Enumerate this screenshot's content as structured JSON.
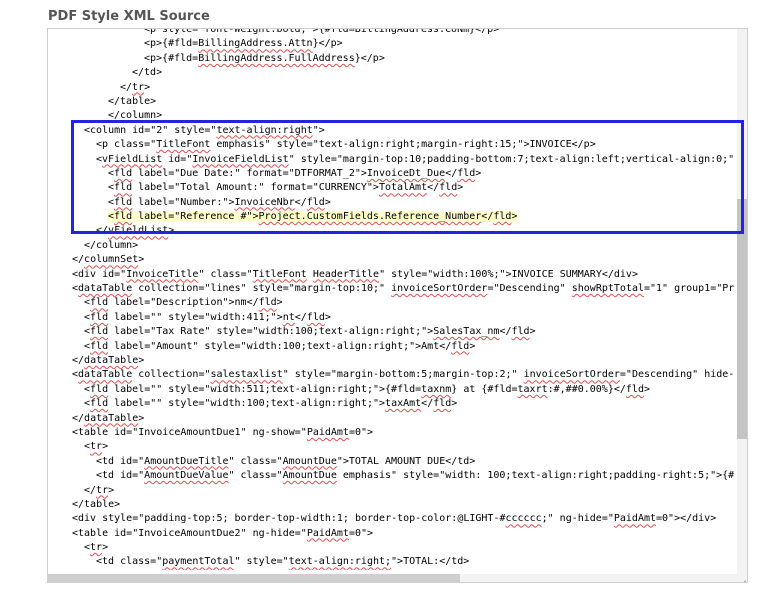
{
  "section_title": "PDF Style XML Source",
  "highlight_color": "#2323e6",
  "lines": [
    {
      "indent": 6,
      "parts": [
        {
          "t": "<p style= font-Weight:bold; >{#fld=BillingAddress.CoNm}</p>"
        }
      ]
    },
    {
      "indent": 6,
      "parts": [
        {
          "t": "<p>{#fld="
        },
        {
          "t": "BillingAddress.Attn",
          "s": true
        },
        {
          "t": "}</p>"
        }
      ]
    },
    {
      "indent": 6,
      "parts": [
        {
          "t": "<p>{#fld="
        },
        {
          "t": "BillingAddress.FullAddress",
          "s": true
        },
        {
          "t": "}</p>"
        }
      ]
    },
    {
      "indent": 5,
      "parts": [
        {
          "t": "</td>"
        }
      ]
    },
    {
      "indent": 4,
      "parts": [
        {
          "t": "</"
        },
        {
          "t": "tr",
          "s": true
        },
        {
          "t": ">"
        }
      ]
    },
    {
      "indent": 3,
      "parts": [
        {
          "t": "</table>"
        }
      ]
    },
    {
      "indent": 3,
      "parts": [
        {
          "t": "</column>"
        }
      ]
    },
    {
      "indent": 1,
      "parts": [
        {
          "t": "<column id=\"2\" style=\""
        },
        {
          "t": "text-align:right",
          "s": true
        },
        {
          "t": "\">"
        }
      ]
    },
    {
      "indent": 2,
      "parts": [
        {
          "t": "<p class=\""
        },
        {
          "t": "TitleFont",
          "s": true
        },
        {
          "t": " emphasis\" style=\"text-align:right;margin-right:15;\">INVOICE</p>"
        }
      ]
    },
    {
      "indent": 2,
      "parts": [
        {
          "t": "<"
        },
        {
          "t": "vFieldList",
          "s": true
        },
        {
          "t": " id=\""
        },
        {
          "t": "InvoiceFieldList",
          "s": true
        },
        {
          "t": "\" style=\"margin-top:10;padding-bottom:7;text-align:left;vertical-align:0;\""
        }
      ]
    },
    {
      "indent": 3,
      "parts": [
        {
          "t": "<"
        },
        {
          "t": "fld",
          "s": true
        },
        {
          "t": " label=\"Due Date:\" format=\"DTFORMAT_2\">"
        },
        {
          "t": "InvoiceDt_Due",
          "s": true
        },
        {
          "t": "</"
        },
        {
          "t": "fld",
          "s": true
        },
        {
          "t": ">"
        }
      ]
    },
    {
      "indent": 3,
      "parts": [
        {
          "t": "<"
        },
        {
          "t": "fld",
          "s": true
        },
        {
          "t": " label=\"Total Amount:\" format=\"CURRENCY\">"
        },
        {
          "t": "TotalAmt",
          "s": true
        },
        {
          "t": "</"
        },
        {
          "t": "fld",
          "s": true
        },
        {
          "t": ">"
        }
      ]
    },
    {
      "indent": 3,
      "parts": [
        {
          "t": "<"
        },
        {
          "t": "fld",
          "s": true
        },
        {
          "t": " label=\"Number:\">"
        },
        {
          "t": "InvoiceNbr",
          "s": true
        },
        {
          "t": "</"
        },
        {
          "t": "fld",
          "s": true
        },
        {
          "t": ">"
        }
      ]
    },
    {
      "indent": 3,
      "hl": true,
      "parts": [
        {
          "t": "<"
        },
        {
          "t": "fld",
          "s": true
        },
        {
          "t": " label=\"Reference #\">"
        },
        {
          "t": "Project.CustomFields.Reference_Number",
          "s": true
        },
        {
          "t": "</"
        },
        {
          "t": "fld",
          "s": true
        },
        {
          "t": ">"
        }
      ]
    },
    {
      "indent": 2,
      "parts": [
        {
          "t": "</"
        },
        {
          "t": "vFieldList",
          "s": true
        },
        {
          "t": ">"
        }
      ]
    },
    {
      "indent": 1,
      "parts": [
        {
          "t": "</column>"
        }
      ]
    },
    {
      "indent": 0,
      "parts": [
        {
          "t": "</"
        },
        {
          "t": "columnSet",
          "s": true
        },
        {
          "t": ">"
        }
      ]
    },
    {
      "indent": 0,
      "parts": [
        {
          "t": "<div id=\""
        },
        {
          "t": "InvoiceTitle",
          "s": true
        },
        {
          "t": "\" class=\""
        },
        {
          "t": "TitleFont",
          "s": true
        },
        {
          "t": " "
        },
        {
          "t": "HeaderTitle",
          "s": true
        },
        {
          "t": "\" style=\"width:100%;\">INVOICE SUMMARY</div>"
        }
      ]
    },
    {
      "indent": 0,
      "parts": [
        {
          "t": "<"
        },
        {
          "t": "dataTable",
          "s": true
        },
        {
          "t": " collection=\"lines\" style=\"margin-top:10;\" "
        },
        {
          "t": "invoiceSortOrder",
          "s": true
        },
        {
          "t": "=\"Descending\" "
        },
        {
          "t": "showRptTotal",
          "s": true
        },
        {
          "t": "=\"1\" group1=\"Pr"
        }
      ]
    },
    {
      "indent": 1,
      "parts": [
        {
          "t": "<"
        },
        {
          "t": "fld",
          "s": true
        },
        {
          "t": " label=\"Description\">nm</"
        },
        {
          "t": "fld",
          "s": true
        },
        {
          "t": ">"
        }
      ]
    },
    {
      "indent": 1,
      "parts": [
        {
          "t": "<"
        },
        {
          "t": "fld",
          "s": true
        },
        {
          "t": " label=\"\" style=\"width:411;\">"
        },
        {
          "t": "nt",
          "s": true
        },
        {
          "t": "</"
        },
        {
          "t": "fld",
          "s": true
        },
        {
          "t": ">"
        }
      ]
    },
    {
      "indent": 1,
      "parts": [
        {
          "t": "<"
        },
        {
          "t": "fld",
          "s": true
        },
        {
          "t": " label=\"Tax Rate\" style=\"width:100;text-align:right;\">"
        },
        {
          "t": "SalesTax_nm",
          "s": true
        },
        {
          "t": "</"
        },
        {
          "t": "fld",
          "s": true
        },
        {
          "t": ">"
        }
      ]
    },
    {
      "indent": 1,
      "parts": [
        {
          "t": "<"
        },
        {
          "t": "fld",
          "s": true
        },
        {
          "t": " label=\"Amount\" style=\"width:100;text-align:right;\">Amt</"
        },
        {
          "t": "fld",
          "s": true
        },
        {
          "t": ">"
        }
      ]
    },
    {
      "indent": 0,
      "parts": [
        {
          "t": "</"
        },
        {
          "t": "dataTable",
          "s": true
        },
        {
          "t": ">"
        }
      ]
    },
    {
      "indent": 0,
      "parts": [
        {
          "t": "<"
        },
        {
          "t": "dataTable",
          "s": true
        },
        {
          "t": " collection=\""
        },
        {
          "t": "salestaxlist",
          "s": true
        },
        {
          "t": "\" style=\"margin-bottom:5;margin-top:2;\" "
        },
        {
          "t": "invoiceSortOrder",
          "s": true
        },
        {
          "t": "=\"Descending\" hide-"
        }
      ]
    },
    {
      "indent": 1,
      "parts": [
        {
          "t": "<"
        },
        {
          "t": "fld",
          "s": true
        },
        {
          "t": " label=\"\" style=\"width:511;text-align:right;\">{#fld="
        },
        {
          "t": "taxnm",
          "s": true
        },
        {
          "t": "} at {#fld="
        },
        {
          "t": "taxrt",
          "s": true
        },
        {
          "t": ":#,##0.00%}</"
        },
        {
          "t": "fld",
          "s": true
        },
        {
          "t": ">"
        }
      ]
    },
    {
      "indent": 1,
      "parts": [
        {
          "t": "<"
        },
        {
          "t": "fld",
          "s": true
        },
        {
          "t": " label=\"\" style=\"width:100;text-align:right;\">"
        },
        {
          "t": "taxAmt",
          "s": true
        },
        {
          "t": "</"
        },
        {
          "t": "fld",
          "s": true
        },
        {
          "t": ">"
        }
      ]
    },
    {
      "indent": 0,
      "parts": [
        {
          "t": "</"
        },
        {
          "t": "dataTable",
          "s": true
        },
        {
          "t": ">"
        }
      ]
    },
    {
      "indent": 0,
      "parts": [
        {
          "t": "<table id=\"InvoiceAmountDue1\" ng-show=\""
        },
        {
          "t": "PaidAmt",
          "s": true
        },
        {
          "t": "=0\">"
        }
      ]
    },
    {
      "indent": 1,
      "parts": [
        {
          "t": "<"
        },
        {
          "t": "tr",
          "s": true
        },
        {
          "t": ">"
        }
      ]
    },
    {
      "indent": 2,
      "parts": [
        {
          "t": "<td id=\""
        },
        {
          "t": "AmountDueTitle",
          "s": true
        },
        {
          "t": "\" class=\""
        },
        {
          "t": "AmountDue",
          "s": true
        },
        {
          "t": "\">TOTAL AMOUNT DUE</td>"
        }
      ]
    },
    {
      "indent": 2,
      "parts": [
        {
          "t": "<td id=\""
        },
        {
          "t": "AmountDueValue",
          "s": true
        },
        {
          "t": "\" class=\""
        },
        {
          "t": "AmountDue",
          "s": true
        },
        {
          "t": " emphasis\" style=\"width: 100;text-align:right;padding-right:5;\">{#"
        }
      ]
    },
    {
      "indent": 1,
      "parts": [
        {
          "t": "</"
        },
        {
          "t": "tr",
          "s": true
        },
        {
          "t": ">"
        }
      ]
    },
    {
      "indent": 0,
      "parts": [
        {
          "t": "</table>"
        }
      ]
    },
    {
      "indent": 0,
      "parts": [
        {
          "t": "<div style=\"padding-top:5; border-top-width:1; border-top-color:@LIGHT-#"
        },
        {
          "t": "cccccc",
          "s": true
        },
        {
          "t": ";\" ng-hide=\""
        },
        {
          "t": "PaidAmt",
          "s": true
        },
        {
          "t": "=0\"></div>"
        }
      ]
    },
    {
      "indent": 0,
      "parts": [
        {
          "t": "<table id=\"InvoiceAmountDue2\" ng-hide=\""
        },
        {
          "t": "PaidAmt",
          "s": true
        },
        {
          "t": "=0\">"
        }
      ]
    },
    {
      "indent": 1,
      "parts": [
        {
          "t": "<"
        },
        {
          "t": "tr",
          "s": true
        },
        {
          "t": ">"
        }
      ]
    },
    {
      "indent": 2,
      "parts": [
        {
          "t": "<td class=\""
        },
        {
          "t": "paymentTotal",
          "s": true
        },
        {
          "t": "\" style=\""
        },
        {
          "t": "text-align:right;",
          "s": true
        },
        {
          "t": "\">TOTAL:</td>"
        }
      ]
    }
  ]
}
